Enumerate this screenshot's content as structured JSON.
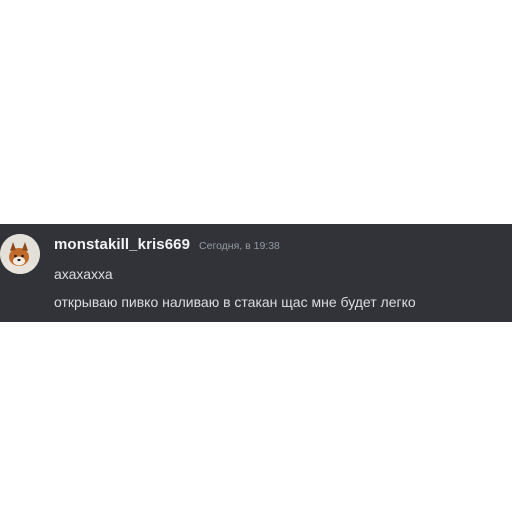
{
  "message": {
    "avatar_icon": "dog-avatar",
    "username": "monstakill_kris669",
    "timestamp": "Сегодня, в 19:38",
    "lines": [
      "ахахахха",
      "открываю пивко наливаю в стакан щас мне будет легко"
    ]
  },
  "colors": {
    "background": "#313338",
    "username": "#f2f3f5",
    "timestamp": "#949ba4",
    "message_text": "#dbdee1"
  }
}
